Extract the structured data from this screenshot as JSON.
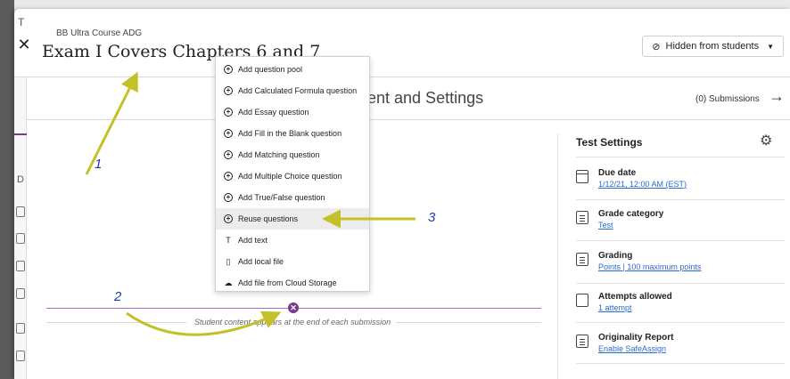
{
  "background": {
    "letters": [
      "T",
      "D"
    ]
  },
  "header": {
    "course_name": "BB Ultra Course ADG",
    "exam_title": "Exam I Covers Chapters 6 and 7",
    "close_label": "✕",
    "visibility_label": "Hidden from students"
  },
  "subheader": {
    "title": "ent and Settings",
    "submissions": "(0) Submissions",
    "arrow": "→"
  },
  "content": {
    "student_note": "Student content appears at the end of each submission"
  },
  "menu": {
    "items": [
      {
        "label": "Add question pool",
        "icon": "plus-circle-icon"
      },
      {
        "label": "Add Calculated Formula question",
        "icon": "plus-circle-icon"
      },
      {
        "label": "Add Essay question",
        "icon": "plus-circle-icon"
      },
      {
        "label": "Add Fill in the Blank question",
        "icon": "plus-circle-icon"
      },
      {
        "label": "Add Matching question",
        "icon": "plus-circle-icon"
      },
      {
        "label": "Add Multiple Choice question",
        "icon": "plus-circle-icon"
      },
      {
        "label": "Add True/False question",
        "icon": "plus-circle-icon"
      },
      {
        "label": "Reuse questions",
        "icon": "plus-circle-icon"
      },
      {
        "label": "Add text",
        "icon": "text-icon"
      },
      {
        "label": "Add local file",
        "icon": "file-add-icon"
      },
      {
        "label": "Add file from Cloud Storage",
        "icon": "cloud-icon"
      }
    ]
  },
  "test_settings": {
    "title": "Test Settings",
    "items": [
      {
        "title": "Due date",
        "link": "1/12/21, 12:00 AM (EST)"
      },
      {
        "title": "Grade category",
        "link": "Test"
      },
      {
        "title": "Grading",
        "link": "Points | 100 maximum points"
      },
      {
        "title": "Attempts allowed",
        "link": "1 attempt"
      },
      {
        "title": "Originality Report",
        "link": "Enable SafeAssign"
      }
    ]
  },
  "annotations": {
    "labels": [
      "1",
      "2",
      "3"
    ],
    "arrow_color": "#c4c02a"
  },
  "colors": {
    "accent_purple": "#7a3b8a",
    "link_blue": "#2a6bd1"
  }
}
